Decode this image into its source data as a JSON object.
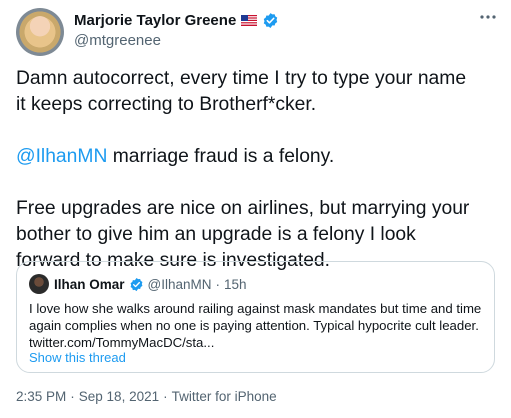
{
  "author": {
    "display_name": "Marjorie Taylor Greene",
    "handle": "@mtgreenee",
    "flag": "us-flag-icon",
    "verified": "verified-badge-icon"
  },
  "tweet": {
    "line1": "Damn autocorrect, every time I try to type your name",
    "line2": "it keeps correcting to Brotherf*cker.",
    "mention": "@IlhanMN",
    "mention_rest": " marriage fraud is a felony.",
    "line4": "Free upgrades are nice on airlines, but marrying your",
    "line5": "bother to give him an upgrade is a felony I look",
    "line6": "forward to make sure is investigated."
  },
  "quote": {
    "display_name": "Ilhan Omar",
    "handle": "@IlhanMN",
    "dot": "·",
    "time": "15h",
    "line1": "I love how she walks around railing against mask mandates but time and time",
    "line2": "again complies when no one is paying attention. Typical hypocrite cult leader.",
    "line3": "twitter.com/TommyMacDC/sta...",
    "show_thread": "Show this thread"
  },
  "meta": {
    "time": "2:35 PM",
    "dot1": "·",
    "date": "Sep 18, 2021",
    "dot2": "·",
    "source": "Twitter for iPhone"
  },
  "colors": {
    "link": "#1d9bf0",
    "secondary_text": "#536471",
    "border": "#cfd9de",
    "verified": "#1d9bf0"
  }
}
